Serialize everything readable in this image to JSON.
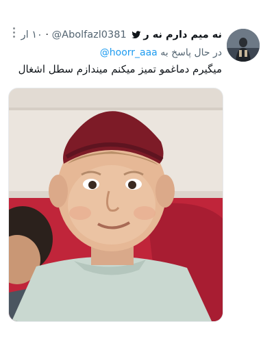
{
  "tweet": {
    "display_name": "نه میم دارم نه ر",
    "handle": "@Abolfazl0381",
    "time": "۱۰ ار",
    "reply_prefix": "در حال پاسخ به",
    "reply_handle": "@hoorr_aaa",
    "text": "میگیرم دماغمو تمیز میکنم میندازم سطل اشغال"
  },
  "icons": {
    "verified_bird": "bird-icon",
    "more": "more-icon"
  },
  "colors": {
    "text_primary": "#0f1419",
    "text_secondary": "#536471",
    "link": "#1d9bf0"
  }
}
